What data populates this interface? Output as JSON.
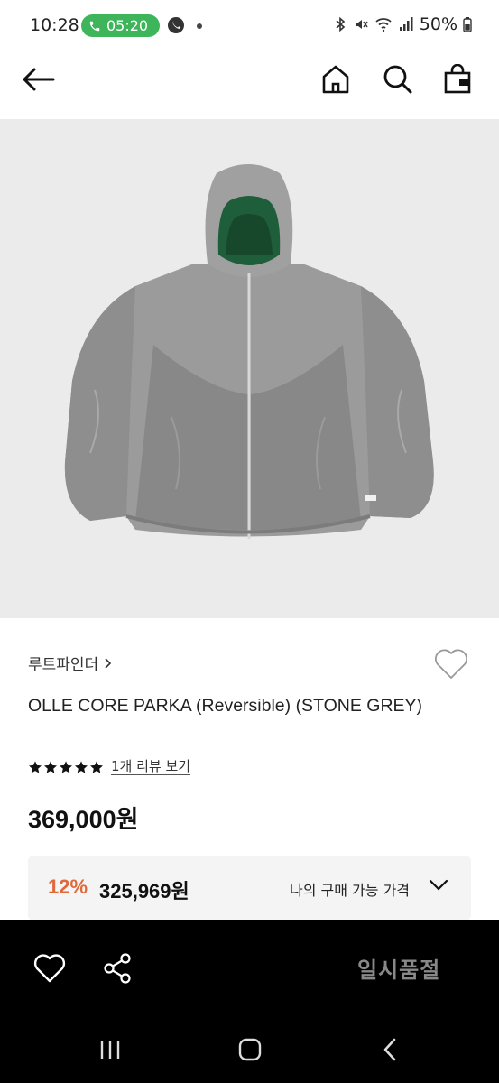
{
  "status_bar": {
    "time": "10:28",
    "call_duration": "05:20",
    "battery": "50%"
  },
  "header": {
    "icons": [
      "back-arrow-icon",
      "home-icon",
      "search-icon",
      "shopping-bag-icon"
    ]
  },
  "product": {
    "brand": "루트파인더",
    "title": "OLLE CORE PARKA (Reversible) (STONE GREY)",
    "rating_stars": 5,
    "review_link": "1개 리뷰 보기",
    "price": "369,000원",
    "discount": {
      "rate": "12%",
      "price": "325,969원",
      "label": "나의 구매 가능 가격"
    }
  },
  "action_bar": {
    "status": "일시품절"
  },
  "colors": {
    "accent_discount": "#e0683a",
    "call_pill": "#3eb55a",
    "image_bg": "#ebebeb"
  }
}
